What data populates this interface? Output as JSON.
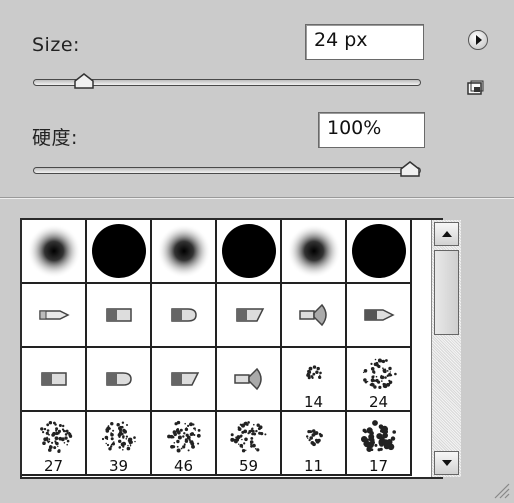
{
  "size": {
    "label": "Size:",
    "value": "24 px",
    "slider_fraction": 0.11
  },
  "hardness": {
    "label": "硬度:",
    "value": "100%",
    "slider_fraction": 1.0
  },
  "icons": {
    "flyout": "flyout-menu-icon",
    "new_preset": "new-preset-icon",
    "scroll_up": "scroll-up-arrow-icon",
    "scroll_down": "scroll-down-arrow-icon",
    "resize": "resize-grip-icon"
  },
  "brushes": [
    [
      {
        "kind": "soft-round",
        "label": ""
      },
      {
        "kind": "hard-round",
        "label": ""
      },
      {
        "kind": "soft-round",
        "label": ""
      },
      {
        "kind": "hard-round",
        "label": ""
      },
      {
        "kind": "soft-round",
        "label": ""
      },
      {
        "kind": "hard-round",
        "label": ""
      }
    ],
    [
      {
        "kind": "pencil",
        "label": ""
      },
      {
        "kind": "flat-tip",
        "label": ""
      },
      {
        "kind": "bullet-tip",
        "label": ""
      },
      {
        "kind": "angled-tip",
        "label": ""
      },
      {
        "kind": "fan-tip",
        "label": ""
      },
      {
        "kind": "marker-tip",
        "label": ""
      }
    ],
    [
      {
        "kind": "flat-tip",
        "label": ""
      },
      {
        "kind": "bullet-tip",
        "label": ""
      },
      {
        "kind": "angled-tip",
        "label": ""
      },
      {
        "kind": "fan-tip",
        "label": ""
      },
      {
        "kind": "scatter-small",
        "label": "14"
      },
      {
        "kind": "scatter-large",
        "label": "24"
      }
    ],
    [
      {
        "kind": "scatter-large",
        "label": "27"
      },
      {
        "kind": "scatter-large",
        "label": "39"
      },
      {
        "kind": "scatter-large",
        "label": "46"
      },
      {
        "kind": "scatter-large",
        "label": "59"
      },
      {
        "kind": "scatter-small",
        "label": "11"
      },
      {
        "kind": "scatter-blob",
        "label": "17"
      }
    ]
  ]
}
